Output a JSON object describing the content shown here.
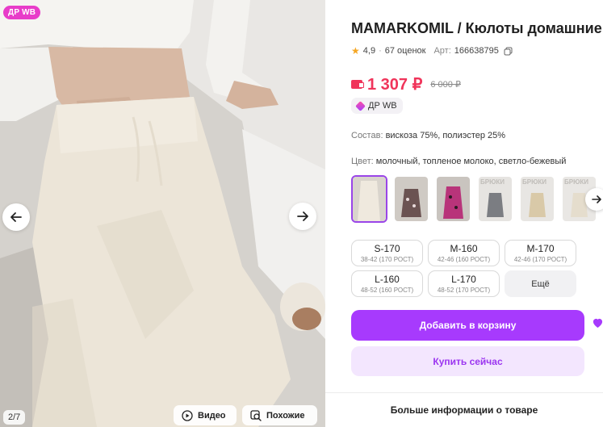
{
  "gallery": {
    "badge": "ДР WB",
    "counter": "2/7",
    "video_label": "Видео",
    "similar_label": "Похожие"
  },
  "product": {
    "title": "MAMARKOMIL / Кюлоты домашние",
    "rating": "4,9",
    "reviews": "67 оценок",
    "article_label": "Арт:",
    "article": "166638795",
    "price": "1 307 ₽",
    "old_price": "6 000 ₽",
    "dr_chip": "ДР WB",
    "composition_label": "Состав:",
    "composition": "вискоза 75%, полиэстер 25%",
    "color_label": "Цвет:",
    "color": "молочный, топленое молоко, светло-бежевый"
  },
  "sizes": [
    {
      "size": "S-170",
      "sub": "38-42 (170 РОСТ)"
    },
    {
      "size": "M-160",
      "sub": "42-46 (160 РОСТ)"
    },
    {
      "size": "M-170",
      "sub": "42-46 (170 РОСТ)"
    },
    {
      "size": "L-160",
      "sub": "48-52 (160 РОСТ)"
    },
    {
      "size": "L-170",
      "sub": "48-52 (170 РОСТ)"
    }
  ],
  "sizes_more": "Ещё",
  "actions": {
    "add_to_cart": "Добавить в корзину",
    "buy_now": "Купить сейчас",
    "more_info": "Больше информации о товаре"
  },
  "thumb_labels": {
    "t4": "БРЮКИ",
    "t5": "БРЮКИ",
    "t6": "БРЮКИ"
  },
  "colors": {
    "accent": "#a73afd",
    "price": "#f0345a",
    "badge": "#e83cc9"
  }
}
